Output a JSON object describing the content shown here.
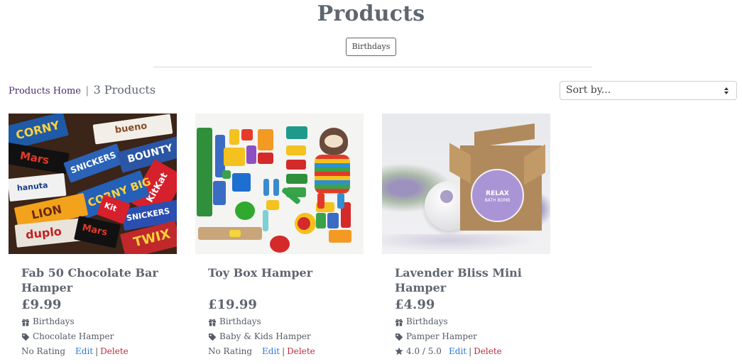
{
  "page": {
    "title": "Products"
  },
  "category_badge": "Birthdays",
  "breadcrumb": {
    "home": "Products Home",
    "separator": "|",
    "count": "3 Products"
  },
  "sort": {
    "value": "Sort by..."
  },
  "colors": {
    "title": "#5f6670",
    "edit": "#2e78d6",
    "delete": "#c0283a",
    "home_link": "#4b2a6e"
  },
  "products": [
    {
      "name": "Fab 50 Chocolate Bar Hamper",
      "price": "£9.99",
      "category": "Birthdays",
      "tag": "Chocolate Hamper",
      "rating": "No Rating",
      "edit": "Edit",
      "sep": "|",
      "delete": "Delete",
      "image_icon": "chocolate-bars-photo"
    },
    {
      "name": "Toy Box Hamper",
      "price": "£19.99",
      "category": "Birthdays",
      "tag": "Baby & Kids Hamper",
      "rating": "No Rating",
      "edit": "Edit",
      "sep": "|",
      "delete": "Delete",
      "image_icon": "toys-photo"
    },
    {
      "name": "Lavender Bliss Mini Hamper",
      "price": "£4.99",
      "category": "Birthdays",
      "tag": "Pamper Hamper",
      "rating": "4.0 / 5.0",
      "edit": "Edit",
      "sep": "|",
      "delete": "Delete",
      "image_icon": "lavender-box-photo"
    }
  ],
  "image_text": {
    "bars": [
      "CORNY",
      "bueno",
      "Mars",
      "SNICKERS",
      "BOUNTY",
      "KitKat",
      "duplo",
      "LION",
      "TWIX",
      "hanuta",
      "CORNY BIG",
      "Mars",
      "SNICKERS",
      "Kit"
    ],
    "lavender_label": [
      "RELAX",
      "BATH BOMB"
    ]
  },
  "icons": {
    "gift": "gift-icon",
    "tag": "tag-icon",
    "star": "star-icon",
    "select": "chevron-updown-icon"
  }
}
